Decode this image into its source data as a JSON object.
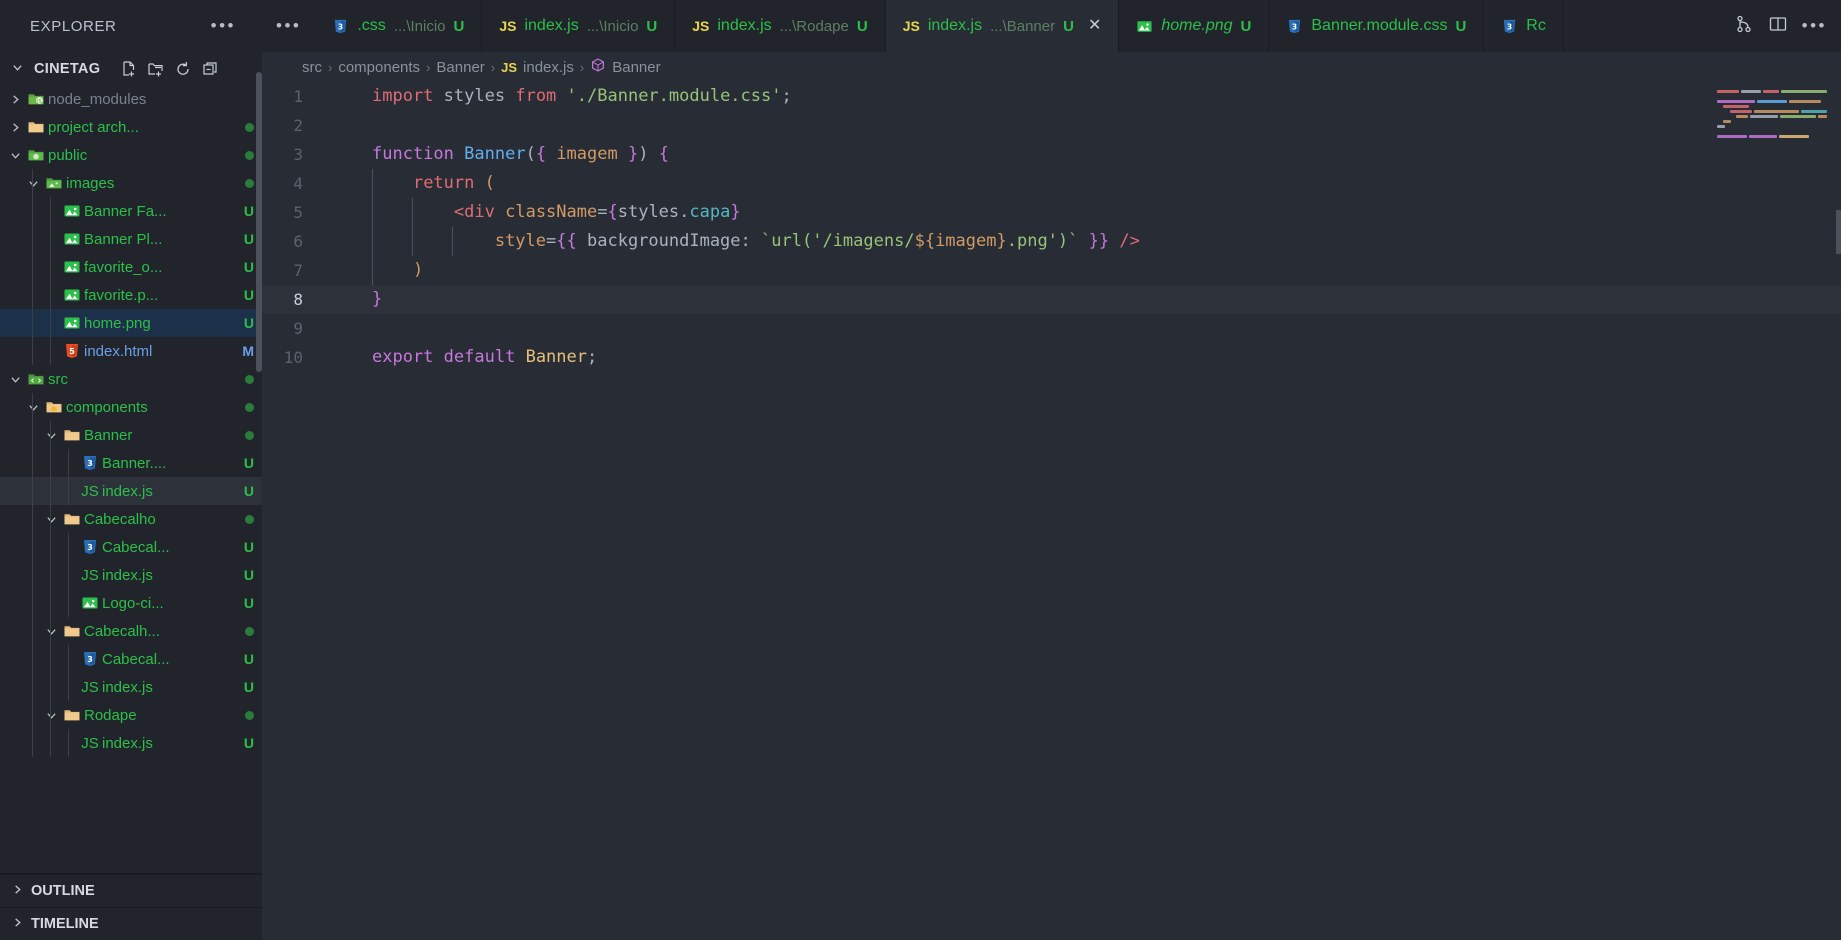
{
  "sidebar": {
    "title": "EXPLORER",
    "more_label": "•••",
    "project": {
      "name": "CINETAG",
      "chevron": "⌄",
      "actions": [
        {
          "name": "new-file",
          "label": "New File"
        },
        {
          "name": "new-folder",
          "label": "New Folder"
        },
        {
          "name": "refresh",
          "label": "Refresh Explorer"
        },
        {
          "name": "collapse-all",
          "label": "Collapse Folders in Explorer"
        }
      ]
    },
    "tree": [
      {
        "label": "node_modules",
        "type": "folder",
        "icon": "folder-node-icon",
        "depth": 1,
        "expanded": false,
        "badge": "",
        "state": "dim",
        "dot": false
      },
      {
        "label": "project arch...",
        "type": "folder",
        "icon": "folder-icon",
        "depth": 1,
        "expanded": false,
        "badge": "",
        "state": "",
        "dot": true
      },
      {
        "label": "public",
        "type": "folder",
        "icon": "folder-public-icon",
        "depth": 1,
        "expanded": true,
        "badge": "",
        "state": "",
        "dot": true
      },
      {
        "label": "images",
        "type": "folder",
        "icon": "folder-images-icon",
        "depth": 2,
        "expanded": true,
        "badge": "",
        "state": "",
        "dot": true
      },
      {
        "label": "Banner Fa...",
        "type": "file",
        "icon": "image-file-icon",
        "depth": 3,
        "expanded": null,
        "badge": "U",
        "state": "",
        "dot": false
      },
      {
        "label": "Banner Pl...",
        "type": "file",
        "icon": "image-file-icon",
        "depth": 3,
        "expanded": null,
        "badge": "U",
        "state": "",
        "dot": false
      },
      {
        "label": "favorite_o...",
        "type": "file",
        "icon": "image-file-icon",
        "depth": 3,
        "expanded": null,
        "badge": "U",
        "state": "",
        "dot": false
      },
      {
        "label": "favorite.p...",
        "type": "file",
        "icon": "image-file-icon",
        "depth": 3,
        "expanded": null,
        "badge": "U",
        "state": "",
        "dot": false
      },
      {
        "label": "home.png",
        "type": "file",
        "icon": "image-file-icon",
        "depth": 3,
        "expanded": null,
        "badge": "U",
        "state": "selected",
        "dot": false
      },
      {
        "label": "index.html",
        "type": "file",
        "icon": "html-file-icon",
        "depth": 3,
        "expanded": null,
        "badge": "M",
        "state": "modified",
        "dot": false
      },
      {
        "label": "src",
        "type": "folder",
        "icon": "folder-src-icon",
        "depth": 1,
        "expanded": true,
        "badge": "",
        "state": "",
        "dot": true
      },
      {
        "label": "components",
        "type": "folder",
        "icon": "folder-components-icon",
        "depth": 2,
        "expanded": true,
        "badge": "",
        "state": "",
        "dot": true
      },
      {
        "label": "Banner",
        "type": "folder",
        "icon": "folder-icon",
        "depth": 3,
        "expanded": true,
        "badge": "",
        "state": "",
        "dot": true
      },
      {
        "label": "Banner....",
        "type": "file",
        "icon": "css-file-icon",
        "depth": 4,
        "expanded": null,
        "badge": "U",
        "state": "",
        "dot": false
      },
      {
        "label": "index.js",
        "type": "file",
        "icon": "js-file-icon",
        "depth": 4,
        "expanded": null,
        "badge": "U",
        "state": "focused",
        "dot": false
      },
      {
        "label": "Cabecalho",
        "type": "folder",
        "icon": "folder-icon",
        "depth": 3,
        "expanded": true,
        "badge": "",
        "state": "",
        "dot": true
      },
      {
        "label": "Cabecal...",
        "type": "file",
        "icon": "css-file-icon",
        "depth": 4,
        "expanded": null,
        "badge": "U",
        "state": "",
        "dot": false
      },
      {
        "label": "index.js",
        "type": "file",
        "icon": "js-file-icon",
        "depth": 4,
        "expanded": null,
        "badge": "U",
        "state": "",
        "dot": false
      },
      {
        "label": "Logo-ci...",
        "type": "file",
        "icon": "image-file-icon",
        "depth": 4,
        "expanded": null,
        "badge": "U",
        "state": "",
        "dot": false
      },
      {
        "label": "Cabecalh...",
        "type": "folder",
        "icon": "folder-icon",
        "depth": 3,
        "expanded": true,
        "badge": "",
        "state": "",
        "dot": true
      },
      {
        "label": "Cabecal...",
        "type": "file",
        "icon": "css-file-icon",
        "depth": 4,
        "expanded": null,
        "badge": "U",
        "state": "",
        "dot": false
      },
      {
        "label": "index.js",
        "type": "file",
        "icon": "js-file-icon",
        "depth": 4,
        "expanded": null,
        "badge": "U",
        "state": "",
        "dot": false
      },
      {
        "label": "Rodape",
        "type": "folder",
        "icon": "folder-icon",
        "depth": 3,
        "expanded": true,
        "badge": "",
        "state": "",
        "dot": true
      },
      {
        "label": "index.js",
        "type": "file",
        "icon": "js-file-icon",
        "depth": 4,
        "expanded": null,
        "badge": "U",
        "state": "",
        "dot": false
      }
    ],
    "panels": [
      {
        "label": "OUTLINE",
        "chevron": "›"
      },
      {
        "label": "TIMELINE",
        "chevron": "›"
      }
    ]
  },
  "tabs": {
    "overflow_label": "•••",
    "items": [
      {
        "icon": "css-file-icon",
        "label": ".css",
        "sub": "...\\Inicio",
        "badge": "U",
        "active": false,
        "preview": false,
        "closable": false
      },
      {
        "icon": "js-file-icon",
        "label": "index.js",
        "sub": "...\\Inicio",
        "badge": "U",
        "active": false,
        "preview": false,
        "closable": false
      },
      {
        "icon": "js-file-icon",
        "label": "index.js",
        "sub": "...\\Rodape",
        "badge": "U",
        "active": false,
        "preview": false,
        "closable": false
      },
      {
        "icon": "js-file-icon",
        "label": "index.js",
        "sub": "...\\Banner",
        "badge": "U",
        "active": true,
        "preview": false,
        "closable": true
      },
      {
        "icon": "image-file-icon",
        "label": "home.png",
        "sub": "",
        "badge": "U",
        "active": false,
        "preview": true,
        "closable": false
      },
      {
        "icon": "css-file-icon",
        "label": "Banner.module.css",
        "sub": "",
        "badge": "U",
        "active": false,
        "preview": false,
        "closable": false
      },
      {
        "icon": "css-file-icon",
        "label": "Rc",
        "sub": "",
        "badge": "",
        "active": false,
        "preview": false,
        "closable": false
      }
    ],
    "close_glyph": "✕",
    "actions": [
      {
        "name": "source-control-icon",
        "label": "Source Control"
      },
      {
        "name": "split-editor-icon",
        "label": "Split Editor Right"
      },
      {
        "name": "editor-actions-icon",
        "label": "More Actions..."
      }
    ]
  },
  "breadcrumb": {
    "separator": "›",
    "items": [
      {
        "label": "src",
        "icon": ""
      },
      {
        "label": "components",
        "icon": ""
      },
      {
        "label": "Banner",
        "icon": ""
      },
      {
        "label": "index.js",
        "icon": "js-file-icon"
      },
      {
        "label": "Banner",
        "icon": "symbol-class-icon"
      }
    ]
  },
  "editor": {
    "active_line": 8,
    "lines": [
      {
        "n": 1,
        "text": "import styles from './Banner.module.css';"
      },
      {
        "n": 2,
        "text": ""
      },
      {
        "n": 3,
        "text": "function Banner({ imagem }) {"
      },
      {
        "n": 4,
        "text": "    return ("
      },
      {
        "n": 5,
        "text": "        <div className={styles.capa}"
      },
      {
        "n": 6,
        "text": "            style={{ backgroundImage: `url('/imagens/${imagem}.png')` }} />"
      },
      {
        "n": 7,
        "text": "    )"
      },
      {
        "n": 8,
        "text": "}"
      },
      {
        "n": 9,
        "text": ""
      },
      {
        "n": 10,
        "text": "export default Banner;"
      }
    ]
  },
  "colors": {
    "editor_bg": "#282c34",
    "sidebar_bg": "#21252b",
    "git_untracked": "#2cbf4a",
    "git_modified": "#6a9fe8",
    "accent_yellow": "#e8d44d",
    "selection": "#1d3049"
  }
}
